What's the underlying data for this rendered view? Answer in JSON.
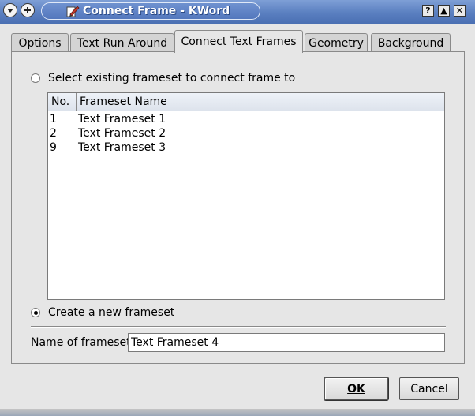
{
  "window": {
    "title": "Connect Frame - KWord",
    "buttons": {
      "help": "?",
      "maximize": "▲",
      "close": "✕"
    }
  },
  "tabs": [
    {
      "label": "Options",
      "active": false
    },
    {
      "label": "Text Run Around",
      "active": false
    },
    {
      "label": "Connect Text Frames",
      "active": true
    },
    {
      "label": "Geometry",
      "active": false
    },
    {
      "label": "Background",
      "active": false
    }
  ],
  "options": {
    "existing_label": "Select existing frameset to connect frame to",
    "existing_checked": false,
    "new_label": "Create a new frameset",
    "new_checked": true
  },
  "frameset_list": {
    "columns": [
      "No.",
      "Frameset Name"
    ],
    "rows": [
      {
        "no": "1",
        "name": "Text Frameset 1"
      },
      {
        "no": "2",
        "name": "Text Frameset 2"
      },
      {
        "no": "9",
        "name": "Text Frameset 3"
      }
    ]
  },
  "name_field": {
    "label": "Name of frameset:",
    "value": "Text Frameset 4"
  },
  "dialog_buttons": {
    "ok": "OK",
    "cancel": "Cancel"
  },
  "colors": {
    "titlebar": "#5a7fc0",
    "dialog_bg": "#e6e6e6"
  },
  "icons": [
    "window-menu-icon",
    "sticky-icon",
    "kword-app-icon",
    "help-icon",
    "maximize-icon",
    "close-icon"
  ]
}
